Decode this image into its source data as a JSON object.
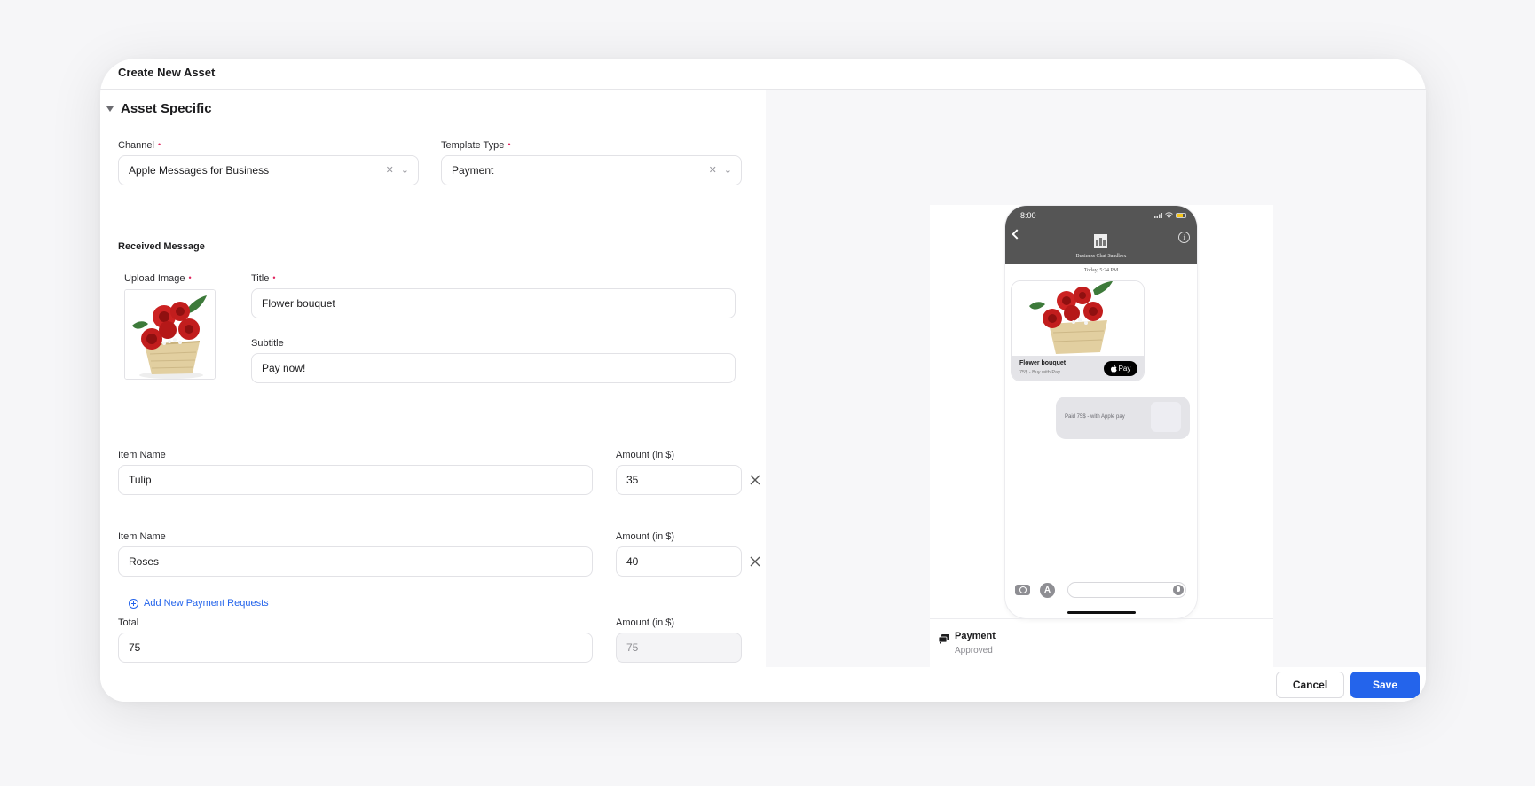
{
  "modal": {
    "title": "Create New Asset",
    "section_title": "Asset Specific",
    "channel": {
      "label": "Channel",
      "value": "Apple Messages for Business"
    },
    "template_type": {
      "label": "Template Type",
      "value": "Payment"
    },
    "received_message_title": "Received Message",
    "upload_image": {
      "label": "Upload Image",
      "image": "flower-bouquet-basket"
    },
    "title_field": {
      "label": "Title",
      "value": "Flower bouquet"
    },
    "subtitle_field": {
      "label": "Subtitle",
      "value": "Pay now!"
    },
    "items": [
      {
        "name_label": "Item Name",
        "name": "Tulip",
        "amount_label": "Amount (in $)",
        "amount": "35"
      },
      {
        "name_label": "Item Name",
        "name": "Roses",
        "amount_label": "Amount (in $)",
        "amount": "40"
      }
    ],
    "add_payment_link": "Add New Payment Requests",
    "total": {
      "label": "Total",
      "value": "75",
      "amount_label": "Amount (in $)",
      "amount": "75"
    },
    "required_marker": "•",
    "footer": {
      "cancel": "Cancel",
      "save": "Save"
    }
  },
  "preview": {
    "phone": {
      "time": "8:00",
      "business_name": "Business Chat Sandbox",
      "date": "Today, 5:24 PM",
      "received_title": "Flower bouquet",
      "received_subtitle": "75$ - Buy with  Pay",
      "apple_pay_label": "Pay",
      "sent_text": "Paid 75$ - with Apple pay",
      "info_glyph": "i",
      "appstore_glyph": "A"
    },
    "template_name": "Payment",
    "template_status": "Approved"
  },
  "colors": {
    "accent": "#2464eb",
    "required": "#e0245e",
    "phone_header": "#555555"
  }
}
